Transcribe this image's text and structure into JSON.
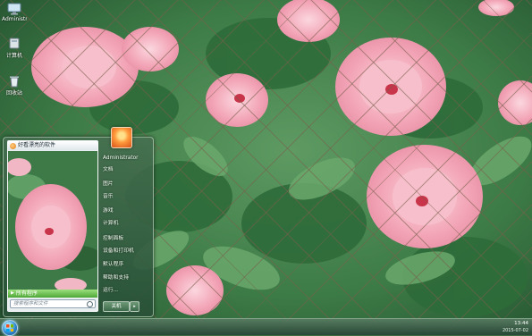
{
  "desktop": {
    "icons": [
      {
        "label": "Administrator",
        "icon": "computer-icon"
      },
      {
        "label": "计算机",
        "icon": "computer-icon"
      },
      {
        "label": "回收站",
        "icon": "recycle-bin-icon"
      }
    ]
  },
  "start_menu": {
    "pinned_item": "好看漂亮的软件",
    "all_programs": "所有程序",
    "search_placeholder": "搜索程序和文件",
    "user_name": "Administrator",
    "items": [
      {
        "label": "文档"
      },
      {
        "label": "图片"
      },
      {
        "label": "音乐"
      },
      {
        "label": "游戏"
      },
      {
        "label": "计算机"
      },
      {
        "label": "控制面板"
      },
      {
        "label": "设备和打印机"
      },
      {
        "label": "默认程序"
      },
      {
        "label": "帮助和支持"
      },
      {
        "label": "运行..."
      }
    ],
    "shutdown_label": "关机",
    "shutdown_arrow": "▸"
  },
  "taskbar": {
    "time": "13:44",
    "date": "2015-07-02",
    "accent": "#4ea637"
  }
}
